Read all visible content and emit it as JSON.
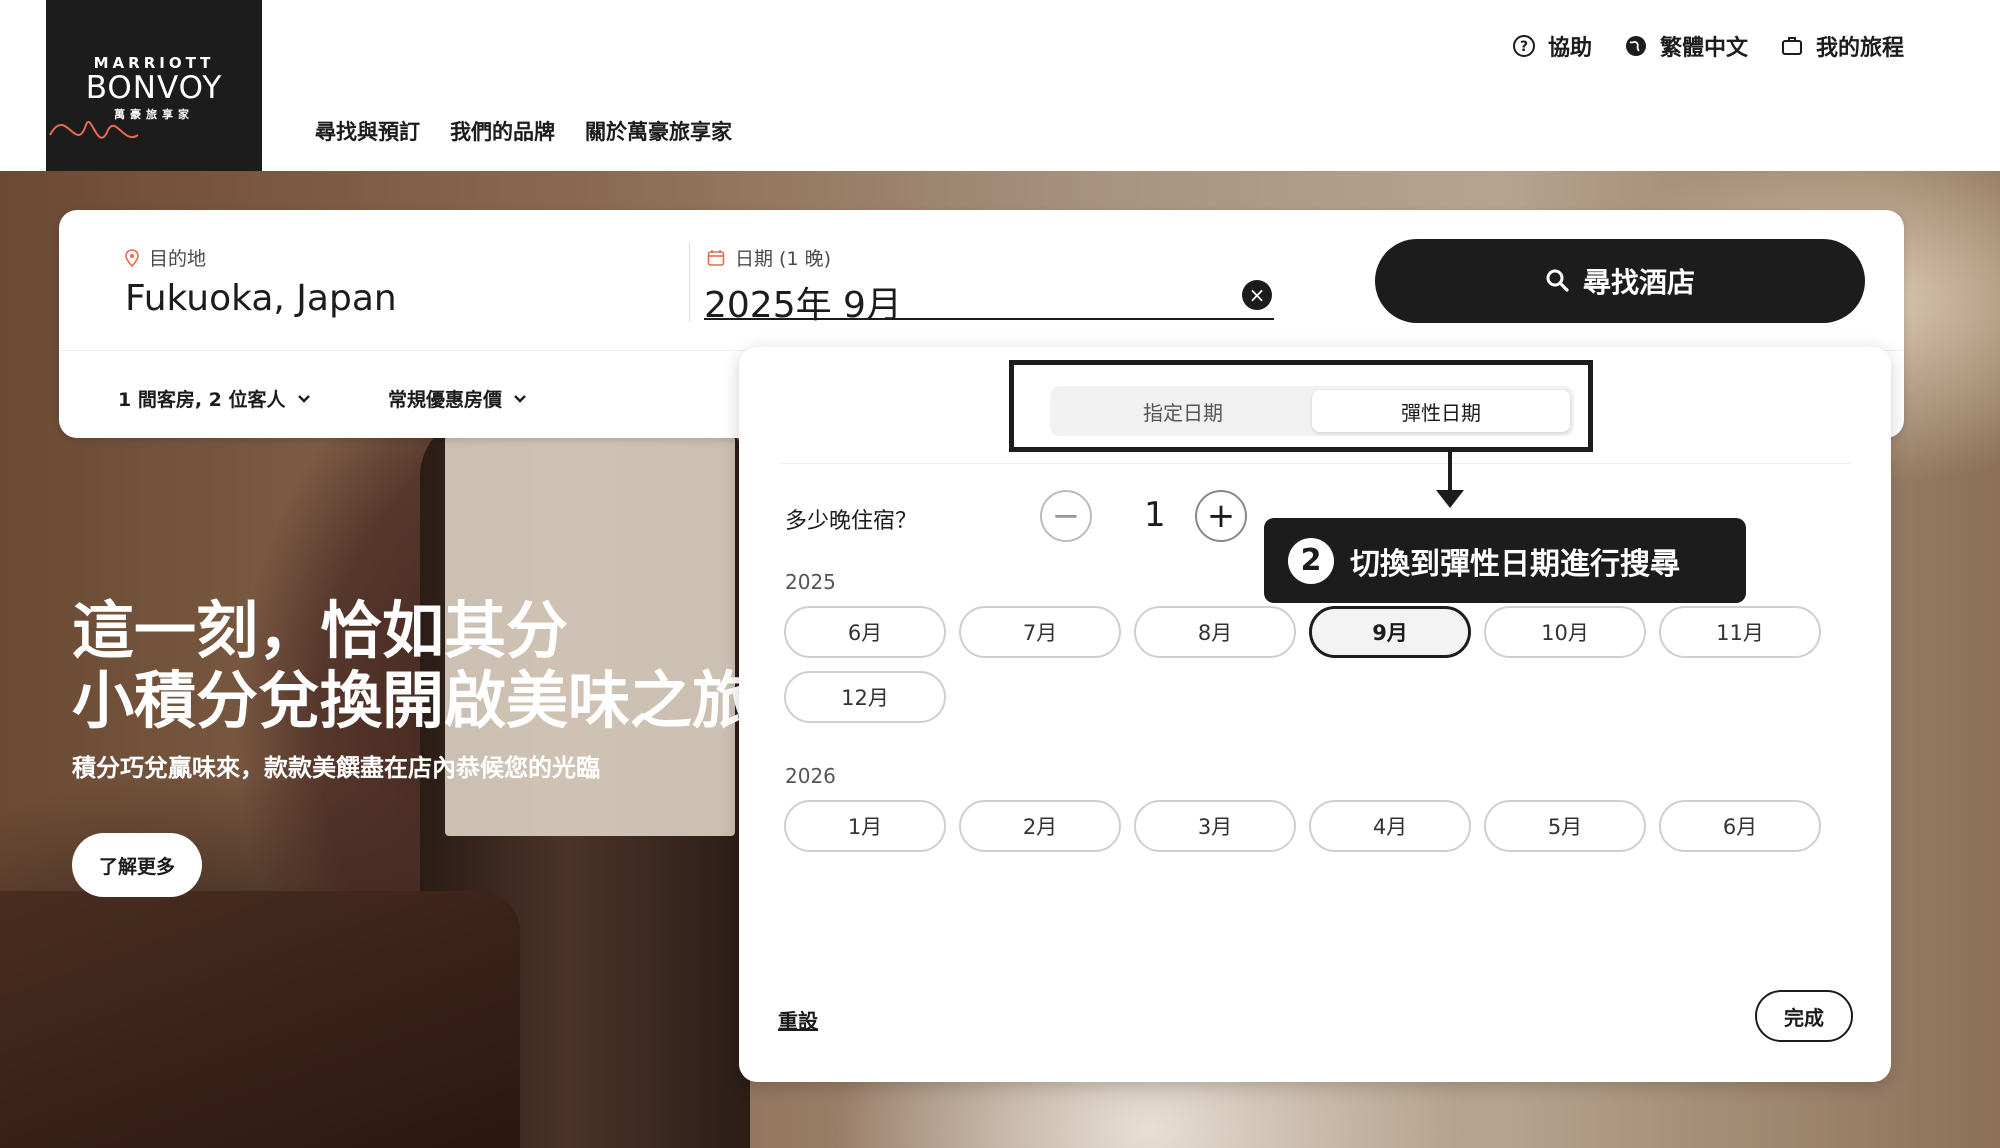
{
  "header": {
    "logo": {
      "line1": "MARRIOTT",
      "line2": "BONVOY",
      "line3": "萬豪旅享家"
    },
    "nav": [
      "尋找與預訂",
      "我們的品牌",
      "關於萬豪旅享家"
    ],
    "utils": {
      "help": "協助",
      "language": "繁體中文",
      "trips": "我的旅程"
    }
  },
  "hero": {
    "title_line1": "這一刻，恰如其分",
    "title_line2": "小積分兌換開啟美味之旅",
    "subtitle": "積分巧兌贏味來，款款美饌盡在店內恭候您的光臨",
    "learn_more": "了解更多"
  },
  "search": {
    "destination_label": "目的地",
    "destination_value": "Fukuoka, Japan",
    "date_label": "日期 (1 晚)",
    "date_value": "2025年 9月",
    "clear_icon": "×",
    "search_button": "尋找酒店",
    "rooms_guests": "1 間客房, 2 位客人",
    "rate": "常規優惠房價"
  },
  "date_picker": {
    "tabs": {
      "specific": "指定日期",
      "flexible": "彈性日期",
      "active": "flexible"
    },
    "nights_label": "多少晚住宿？",
    "nights_value": "1",
    "minus": "−",
    "plus": "+",
    "years": [
      {
        "year": "2025",
        "months": [
          "6月",
          "7月",
          "8月",
          "9月",
          "10月",
          "11月",
          "12月"
        ]
      },
      {
        "year": "2026",
        "months": [
          "1月",
          "2月",
          "3月",
          "4月",
          "5月",
          "6月"
        ]
      }
    ],
    "selected_month": "9月",
    "reset": "重設",
    "done": "完成"
  },
  "annotation": {
    "number": "2",
    "text": "切換到彈性日期進行搜尋"
  },
  "colors": {
    "primary": "#1c1c1c",
    "accent": "#e86a4f"
  }
}
